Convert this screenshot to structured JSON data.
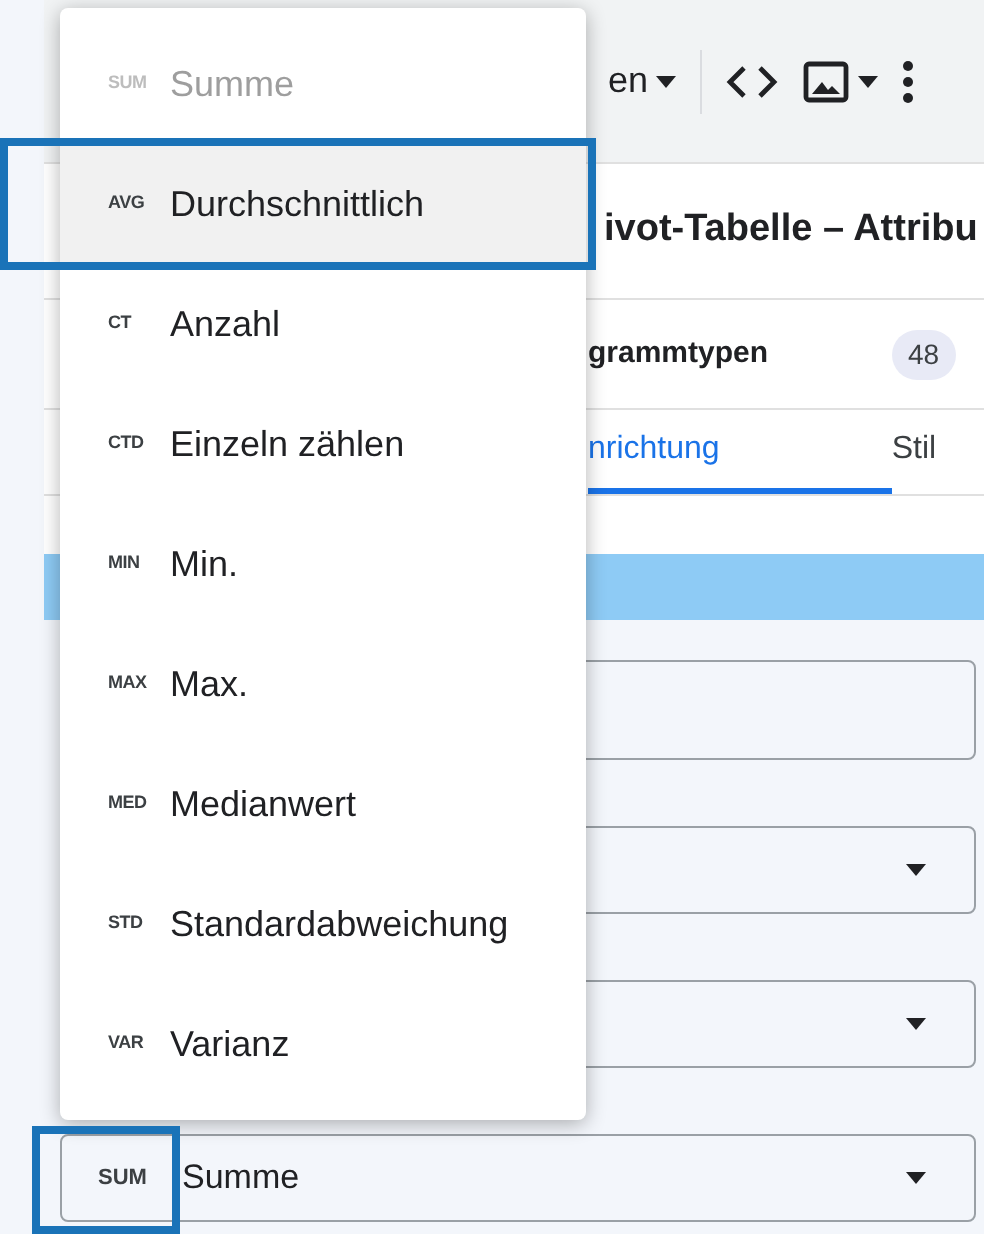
{
  "toolbar": {
    "menu_label": "en"
  },
  "panel": {
    "title": "ivot-Tabelle – Attribu",
    "row_label": "grammtypen",
    "row_count": "48"
  },
  "tabs": [
    {
      "label": "nrichtung",
      "selected": true
    },
    {
      "label": "Stil",
      "selected": false
    }
  ],
  "fields": [
    {
      "kind": "text"
    },
    {
      "kind": "select"
    },
    {
      "kind": "select"
    },
    {
      "kind": "select",
      "prefix": "SUM",
      "value": "Summe",
      "prefix_highlighted": true
    }
  ],
  "menu": {
    "items": [
      {
        "code": "SUM",
        "label": "Summe",
        "disabled": true,
        "selected": false,
        "highlighted": false
      },
      {
        "code": "AVG",
        "label": "Durchschnittlich",
        "disabled": false,
        "selected": true,
        "highlighted": true
      },
      {
        "code": "CT",
        "label": "Anzahl",
        "disabled": false,
        "selected": false,
        "highlighted": false
      },
      {
        "code": "CTD",
        "label": "Einzeln zählen",
        "disabled": false,
        "selected": false,
        "highlighted": false
      },
      {
        "code": "MIN",
        "label": "Min.",
        "disabled": false,
        "selected": false,
        "highlighted": false
      },
      {
        "code": "MAX",
        "label": "Max.",
        "disabled": false,
        "selected": false,
        "highlighted": false
      },
      {
        "code": "MED",
        "label": "Medianwert",
        "disabled": false,
        "selected": false,
        "highlighted": false
      },
      {
        "code": "STD",
        "label": "Standardabweichung",
        "disabled": false,
        "selected": false,
        "highlighted": false
      },
      {
        "code": "VAR",
        "label": "Varianz",
        "disabled": false,
        "selected": false,
        "highlighted": false
      }
    ]
  }
}
